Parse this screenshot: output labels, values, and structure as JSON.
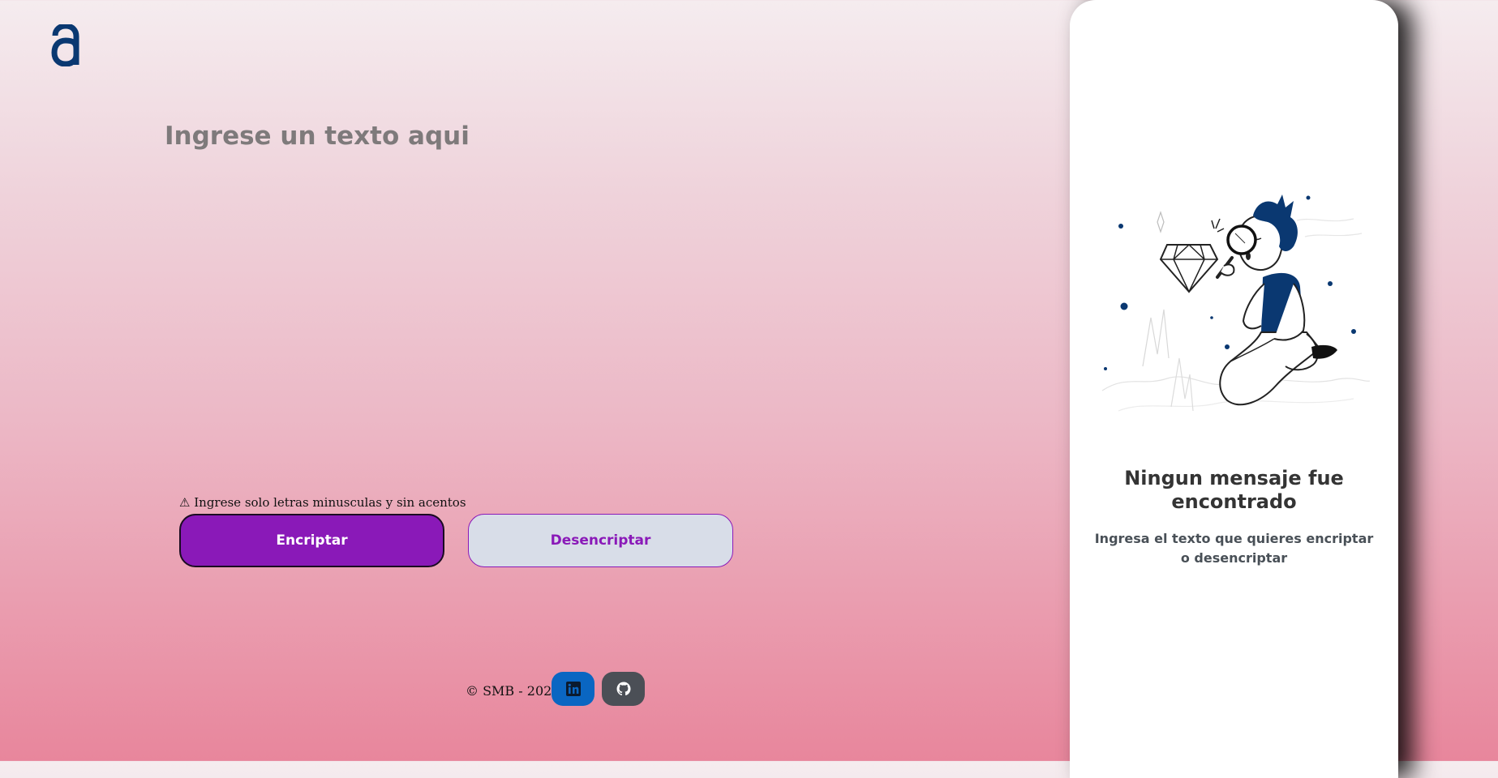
{
  "logo": {
    "icon": "alura-logo-icon",
    "color": "#0a3871"
  },
  "input": {
    "placeholder": "Ingrese un texto aqui",
    "value": ""
  },
  "warning": {
    "icon": "warning-icon",
    "symbol": "⚠",
    "text": "Ingrese solo letras minusculas y sin acentos"
  },
  "buttons": {
    "encrypt_label": "Encriptar",
    "decrypt_label": "Desencriptar"
  },
  "footer": {
    "copyright": "© SMB - 2022",
    "linkedin_icon": "linkedin-icon",
    "github_icon": "github-icon"
  },
  "output_panel": {
    "title": "Ningun mensaje fue encontrado",
    "description": "Ingresa el texto que quieres encriptar o desencriptar",
    "illustration": "person-with-magnifying-glass-and-diamond-illustration"
  },
  "colors": {
    "accent": "#8a19b8",
    "brand": "#0a3871",
    "linkedin": "#0a66c2",
    "github": "#4b4f56"
  }
}
